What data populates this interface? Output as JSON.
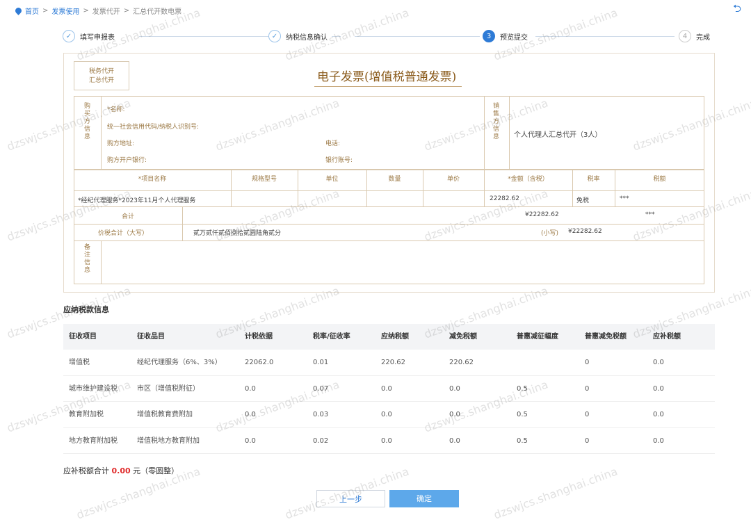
{
  "breadcrumb": {
    "home": "首页",
    "items": [
      "发票使用",
      "发票代开",
      "汇总代开数电票"
    ]
  },
  "steps": [
    {
      "num": "✓",
      "label": "填写申报表",
      "state": "done"
    },
    {
      "num": "✓",
      "label": "纳税信息确认",
      "state": "done"
    },
    {
      "num": "3",
      "label": "预览提交",
      "state": "active"
    },
    {
      "num": "4",
      "label": "完成",
      "state": "todo"
    }
  ],
  "invoice": {
    "stamp_line1": "税务代开",
    "stamp_line2": "汇总代开",
    "title": "电子发票(增值税普通发票)",
    "buyer_label": "购买方信息",
    "buyer_name_label": "*名称:",
    "buyer_tax_label": "统一社会信用代码/纳税人识别号:",
    "buyer_address_label": "购方地址:",
    "buyer_phone_label": "电话:",
    "buyer_bank_label": "购方开户银行:",
    "buyer_account_label": "银行账号:",
    "seller_label": "销售方信息",
    "seller_name": "个人代理人汇总代开（3人）",
    "columns": [
      "*项目名称",
      "规格型号",
      "单位",
      "数量",
      "单价",
      "*金额（含税）",
      "税率",
      "税额"
    ],
    "item": {
      "name": "*经纪代理服务*2023年11月个人代理服务",
      "amount": "22282.62",
      "rate": "免税",
      "tax": "***"
    },
    "sum_label": "合计",
    "sum_amount": "¥22282.62",
    "sum_tax": "***",
    "total_label": "价税合计（大写）",
    "total_words": "贰万贰仟贰佰捌拾贰圆陆角贰分",
    "total_small_label": "(小写)",
    "total_small": "¥22282.62",
    "remark_label": "备注信息"
  },
  "tax_section": {
    "title": "应纳税款信息",
    "headers": [
      "征收项目",
      "征收品目",
      "计税依据",
      "税率/征收率",
      "应纳税额",
      "减免税额",
      "普惠减征幅度",
      "普惠减免税额",
      "应补税额"
    ],
    "rows": [
      [
        "增值税",
        "经纪代理服务（6%、3%）",
        "22062.0",
        "0.01",
        "220.62",
        "220.62",
        "",
        "0",
        "0.0"
      ],
      [
        "城市维护建设税",
        "市区（增值税附征）",
        "0.0",
        "0.07",
        "0.0",
        "0.0",
        "0.5",
        "0",
        "0.0"
      ],
      [
        "教育附加税",
        "增值税教育费附加",
        "0.0",
        "0.03",
        "0.0",
        "0.0",
        "0.5",
        "0",
        "0.0"
      ],
      [
        "地方教育附加税",
        "增值税地方教育附加",
        "0.0",
        "0.02",
        "0.0",
        "0.0",
        "0.5",
        "0",
        "0.0"
      ]
    ]
  },
  "summary": {
    "label": "应补税额合计",
    "amount": "0.00",
    "unit": "元（零圆整）"
  },
  "buttons": {
    "prev": "上一步",
    "confirm": "确定"
  },
  "watermark": "dzswjcs.shanghai.china",
  "colors": {
    "accent": "#2e7bd6",
    "invoice_brown": "#9c7a46",
    "amount_red": "#e02c2c",
    "confirm_bg": "#5da8ea"
  }
}
